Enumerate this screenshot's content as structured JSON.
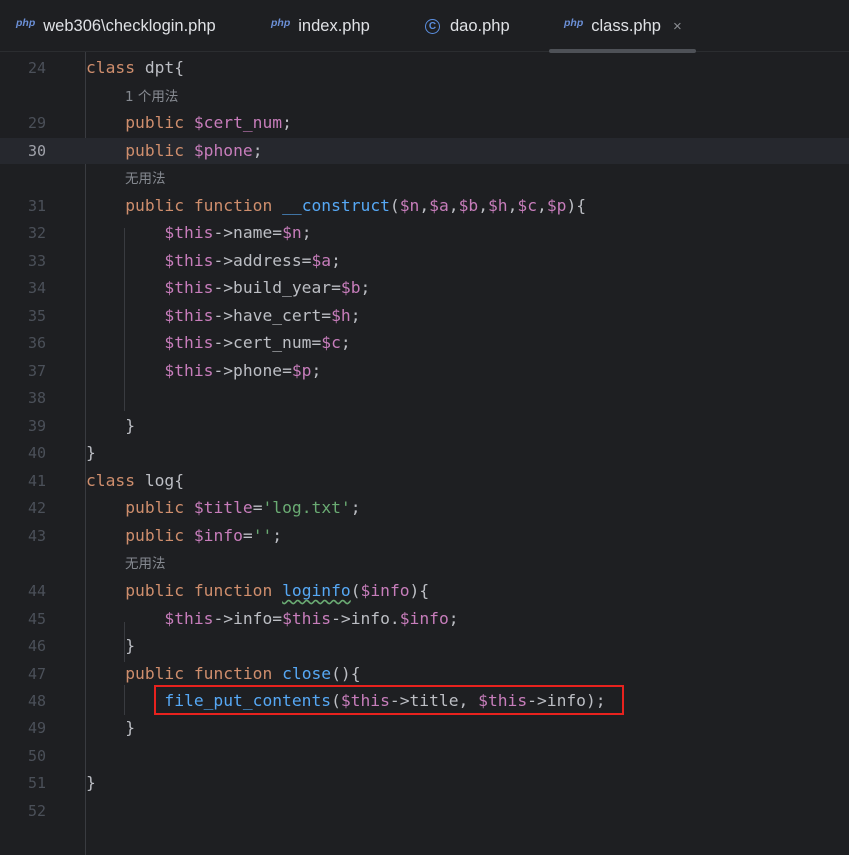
{
  "tabs": [
    {
      "icon": "php-icon",
      "badge": "php",
      "label": "web306\\checklogin.php",
      "active": false
    },
    {
      "icon": "php-icon",
      "badge": "php",
      "label": "index.php",
      "active": false
    },
    {
      "icon": "class-icon",
      "badge": "C",
      "label": "dao.php",
      "active": false
    },
    {
      "icon": "php-icon",
      "badge": "php",
      "label": "class.php",
      "active": true,
      "close": "×"
    }
  ],
  "editor": {
    "lines": [
      {
        "num": "24",
        "code": "class dpt{"
      },
      {
        "hint": "1 个用法"
      },
      {
        "num": "29",
        "code": "    public $cert_num;"
      },
      {
        "num": "30",
        "code": "    public $phone;",
        "current": true
      },
      {
        "hint": "无用法"
      },
      {
        "num": "31",
        "code": "    public function __construct($n,$a,$b,$h,$c,$p){"
      },
      {
        "num": "32",
        "code": "        $this->name=$n;"
      },
      {
        "num": "33",
        "code": "        $this->address=$a;"
      },
      {
        "num": "34",
        "code": "        $this->build_year=$b;"
      },
      {
        "num": "35",
        "code": "        $this->have_cert=$h;"
      },
      {
        "num": "36",
        "code": "        $this->cert_num=$c;"
      },
      {
        "num": "37",
        "code": "        $this->phone=$p;"
      },
      {
        "num": "38",
        "code": ""
      },
      {
        "num": "39",
        "code": "    }"
      },
      {
        "num": "40",
        "code": "}"
      },
      {
        "num": "41",
        "code": "class log{"
      },
      {
        "num": "42",
        "code": "    public $title='log.txt';"
      },
      {
        "num": "43",
        "code": "    public $info='';"
      },
      {
        "hint": "无用法"
      },
      {
        "num": "44",
        "code": "    public function loginfo($info){"
      },
      {
        "num": "45",
        "code": "        $this->info=$this->info.$info;"
      },
      {
        "num": "46",
        "code": "    }"
      },
      {
        "num": "47",
        "code": "    public function close(){"
      },
      {
        "num": "48",
        "code": "        file_put_contents($this->title, $this->info);",
        "highlighted": true
      },
      {
        "num": "49",
        "code": "    }"
      },
      {
        "num": "50",
        "code": ""
      },
      {
        "num": "51",
        "code": "}"
      },
      {
        "num": "52",
        "code": ""
      }
    ]
  },
  "colors": {
    "background": "#1e1f22",
    "keyword": "#cf8e6d",
    "variable": "#c77dbb",
    "function": "#56a8f5",
    "string": "#6aab73",
    "highlight_box": "#e8221e"
  }
}
